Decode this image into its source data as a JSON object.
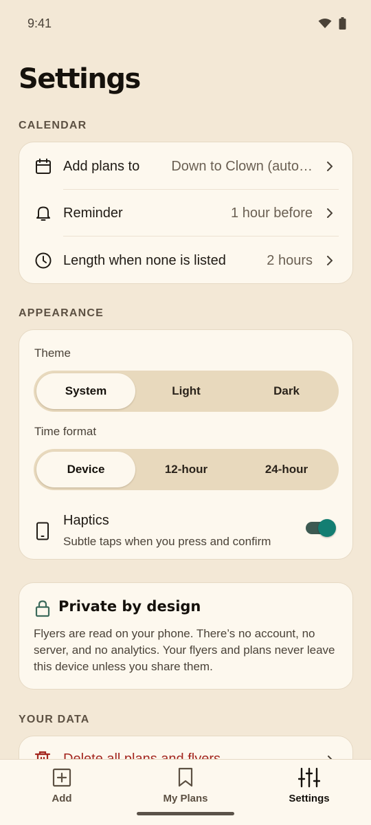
{
  "status": {
    "time": "9:41"
  },
  "title": "Settings",
  "calendar": {
    "section_label": "CALENDAR",
    "rows": [
      {
        "label": "Add plans to",
        "value": "Down to Clown (auto…",
        "icon": "calendar-icon"
      },
      {
        "label": "Reminder",
        "value": "1 hour before",
        "icon": "bell-icon"
      },
      {
        "label": "Length when none is listed",
        "value": "2 hours",
        "icon": "clock-icon"
      }
    ]
  },
  "appearance": {
    "section_label": "APPEARANCE",
    "theme": {
      "label": "Theme",
      "options": [
        "System",
        "Light",
        "Dark"
      ],
      "selected": "System"
    },
    "time_format": {
      "label": "Time format",
      "options": [
        "Device",
        "12-hour",
        "24-hour"
      ],
      "selected": "Device"
    },
    "haptics": {
      "title": "Haptics",
      "subtitle": "Subtle taps when you press and confirm",
      "enabled": true,
      "icon": "phone-icon"
    }
  },
  "privacy": {
    "title": "Private by design",
    "body": "Flyers are read on your phone. There’s no account, no server, and no analytics. Your flyers and plans never leave this device unless you share them.",
    "icon": "lock-icon"
  },
  "your_data": {
    "section_label": "YOUR DATA",
    "delete_label": "Delete all plans and flyers",
    "icon": "trash-icon"
  },
  "nav": {
    "items": [
      {
        "label": "Add",
        "icon": "add-icon"
      },
      {
        "label": "My Plans",
        "icon": "bookmark-icon"
      },
      {
        "label": "Settings",
        "icon": "sliders-icon"
      }
    ],
    "active": "Settings"
  },
  "colors": {
    "background": "#f3e8d6",
    "card": "#fdf8ee",
    "segment_track": "#e8d9bd",
    "toggle_on": "#137e72",
    "danger": "#a3261e",
    "lock_accent": "#3d6b5c"
  }
}
